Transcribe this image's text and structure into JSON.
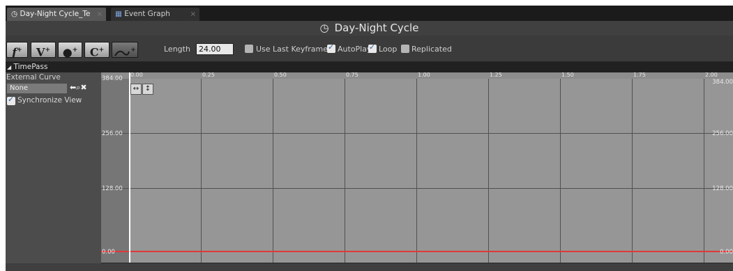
{
  "tabs": [
    {
      "label": "Day-Night Cycle_Te",
      "icon": "clock-icon",
      "close": "×"
    },
    {
      "label": "Event Graph",
      "icon": "graph-icon",
      "close": "×"
    }
  ],
  "title": {
    "text": "Day-Night Cycle",
    "icon": "clock-icon"
  },
  "toolbar": {
    "buttons": [
      {
        "label": "f",
        "plus": "+",
        "name": "add-float-track"
      },
      {
        "label": "V",
        "plus": "+",
        "name": "add-vector-track"
      },
      {
        "label": "⬬",
        "plus": "+",
        "name": "add-event-track"
      },
      {
        "label": "C",
        "plus": "+",
        "name": "add-color-track"
      },
      {
        "label": "",
        "plus": "+",
        "name": "add-curve-asset"
      }
    ],
    "length_label": "Length",
    "length_value": "24.00",
    "use_last_keyframe": {
      "label": "Use Last Keyframe?",
      "checked": false
    },
    "autoplay": {
      "label": "AutoPlay",
      "checked": true
    },
    "loop": {
      "label": "Loop",
      "checked": true
    },
    "replicated": {
      "label": "Replicated",
      "checked": false
    }
  },
  "track": {
    "name": "TimePass",
    "external_curve_label": "External Curve",
    "external_curve_value": "None",
    "synchronize_view": {
      "label": "Synchronize View",
      "checked": true
    }
  },
  "graph": {
    "x_ticks": [
      "0.00",
      "0.25",
      "0.50",
      "0.75",
      "1.00",
      "1.25",
      "1.50",
      "1.75",
      "2.00"
    ],
    "y_ticks": [
      "384.00",
      "256.00",
      "128.00",
      "0.00"
    ],
    "y_ticks_right": [
      "384.00",
      "256.00",
      "128.00",
      "0.00"
    ],
    "curve_color": "#e03838",
    "curve_value": 0,
    "playhead_time": 0
  },
  "colors": {
    "accent": "#2b5a9b",
    "background": "#262626",
    "graph": "#969696"
  }
}
